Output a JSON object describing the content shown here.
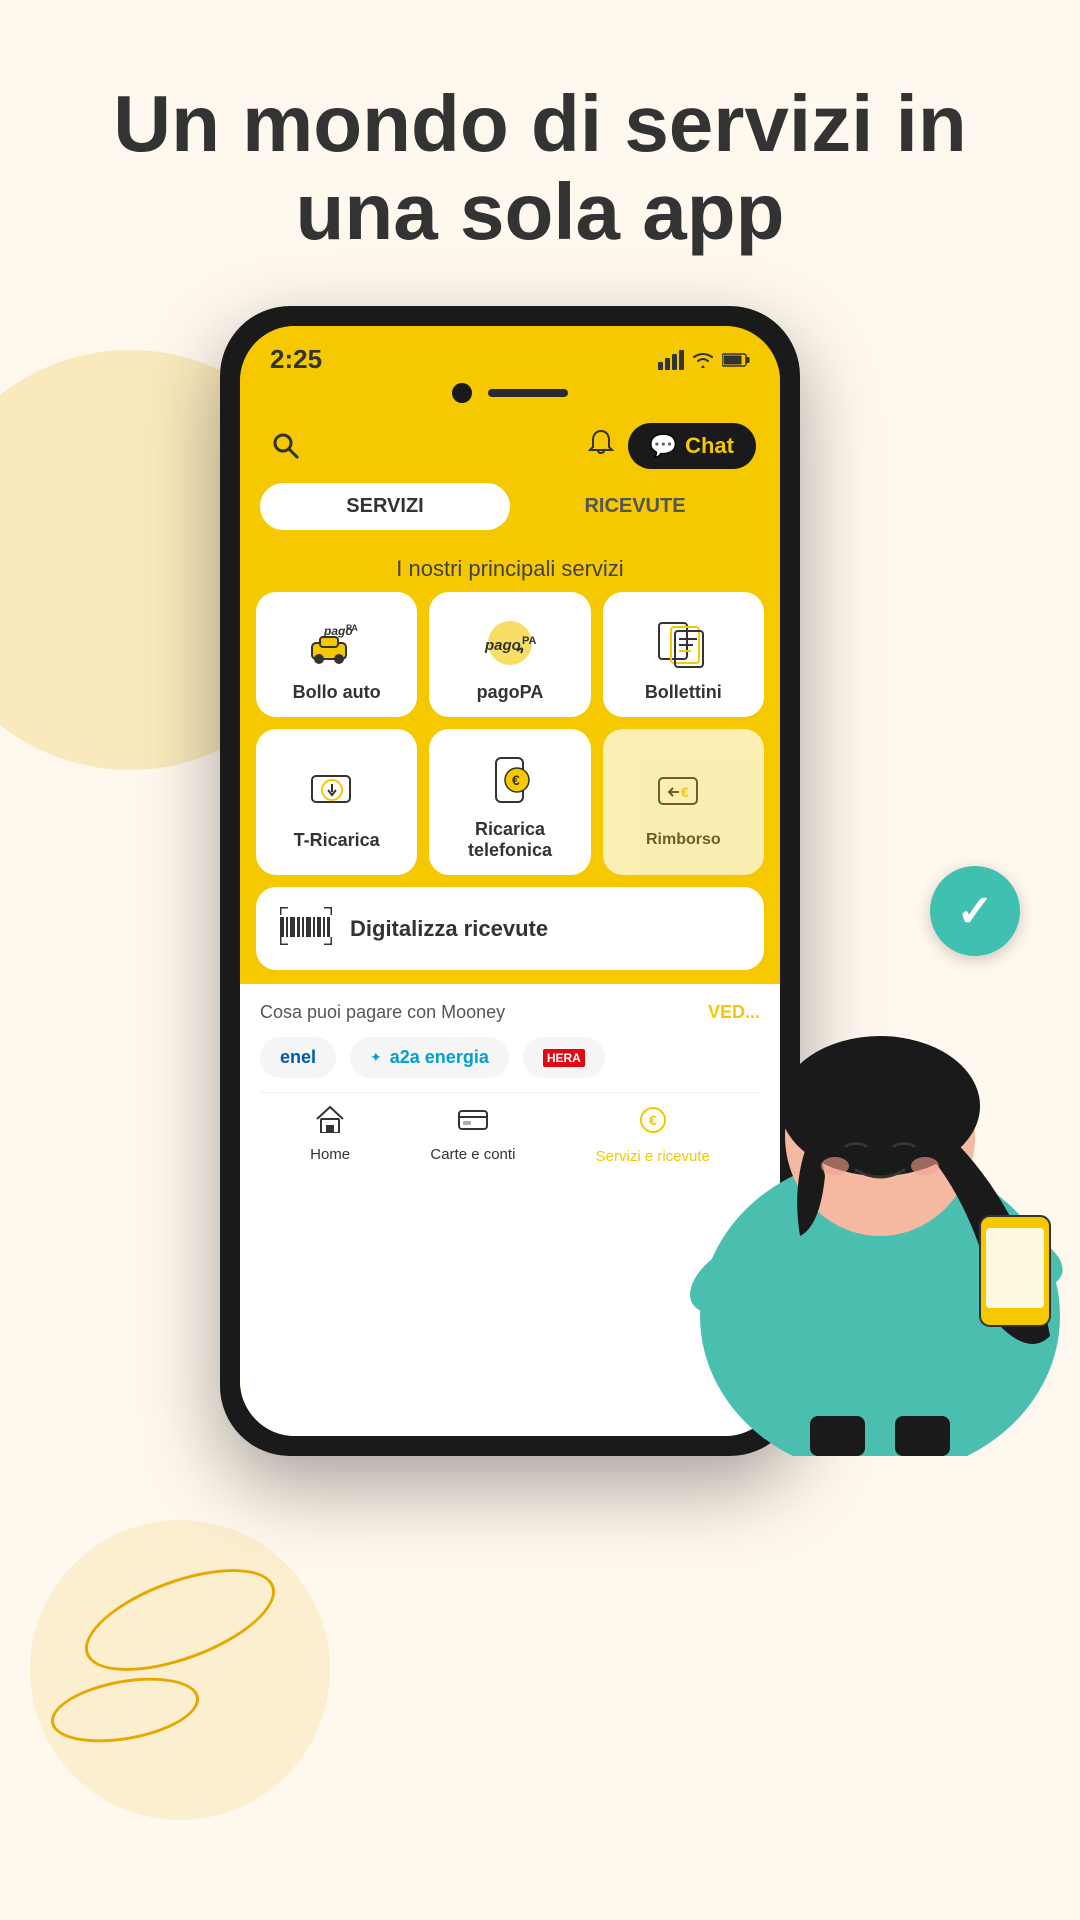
{
  "headline": {
    "line1": "Un mondo di servizi in",
    "line2": "una sola app"
  },
  "phone": {
    "time": "2:25",
    "search_label": "search",
    "chat_label": "Chat",
    "tabs": [
      {
        "id": "servizi",
        "label": "SERVIZI",
        "active": true
      },
      {
        "id": "ricevute",
        "label": "RICEVUTE",
        "active": false
      }
    ],
    "section_title": "I nostri principali servizi",
    "services": [
      {
        "id": "bollo-auto",
        "label": "Bollo auto",
        "icon": "bollo"
      },
      {
        "id": "pagopa",
        "label": "pagoPA",
        "icon": "pagopa2"
      },
      {
        "id": "bollettini",
        "label": "Bollettini",
        "icon": "bollettini"
      },
      {
        "id": "t-ricarica",
        "label": "T-Ricarica",
        "icon": "t-ricarica"
      },
      {
        "id": "ricarica-tel",
        "label": "Ricarica telefonica",
        "icon": "ricarica-tel"
      },
      {
        "id": "rimborso",
        "label": "Rimborso",
        "icon": "rimborso"
      }
    ],
    "digitalizza": {
      "label": "Digitalizza ricevute"
    },
    "pagare": {
      "title": "Cosa puoi pagare con Mooney",
      "vedi_label": "VED...",
      "partners": [
        {
          "id": "enel",
          "label": "enel"
        },
        {
          "id": "a2a",
          "label": "a2a energia"
        },
        {
          "id": "hera",
          "label": "HERA"
        }
      ]
    },
    "bottom_nav": [
      {
        "id": "home",
        "label": "Home",
        "icon": "house",
        "active": true
      },
      {
        "id": "carte",
        "label": "Carte e conti",
        "icon": "cards",
        "active": false
      },
      {
        "id": "servizi-ricevute",
        "label": "Servizi e ricevute",
        "icon": "coin",
        "active": true
      }
    ]
  }
}
